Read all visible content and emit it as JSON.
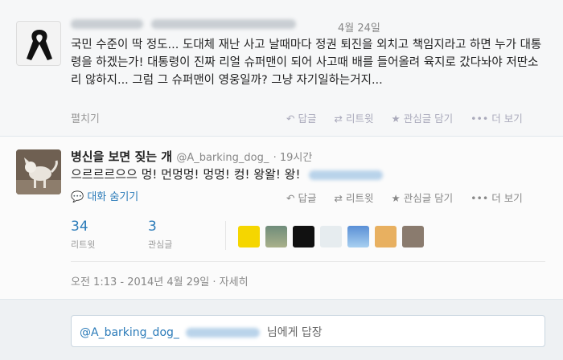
{
  "parent": {
    "date": "4월 24일",
    "text": "국민 수준이 딱 정도... 도대체 재난 사고 날때마다 정권 퇴진을 외치고 책임지라고 하면 누가 대통령을 하겠는가! 대통령이 진짜 리얼 슈퍼맨이 되어 사고때 배를 들어올려 육지로 갔다놔야 저딴소리 않하지... 그럼 그 슈퍼맨이 영웅일까? 그냥 자기일하는거지...",
    "expand_label": "펼치기",
    "actions": {
      "reply": "답글",
      "retweet": "리트윗",
      "favorite": "관심글 담기",
      "more": "더 보기"
    }
  },
  "main": {
    "name": "병신을 보면 짖는 개",
    "handle": "@A_barking_dog_",
    "time": "19시간",
    "text": "으르르르으으 멍! 먼멍멍! 멍멍! 컹! 왕왈! 왕!",
    "convo_label": "대화 숨기기",
    "actions": {
      "reply": "답글",
      "retweet": "리트윗",
      "favorite": "관심글 담기",
      "more": "더 보기"
    },
    "stats": {
      "retweets": "34",
      "retweets_label": "리트윗",
      "favorites": "3",
      "favorites_label": "관심글"
    },
    "timestamp": "오전 1:13 - 2014년 4월 29일",
    "details_label": "자세히"
  },
  "reply": {
    "handle": "@A_barking_dog_",
    "suffix": "님에게 답장"
  },
  "colors": {
    "link": "#2b7bb9",
    "muted": "#888888"
  },
  "icons": [
    "reply-icon",
    "retweet-icon",
    "star-icon",
    "more-dots-icon",
    "chat-bubble-icon"
  ]
}
